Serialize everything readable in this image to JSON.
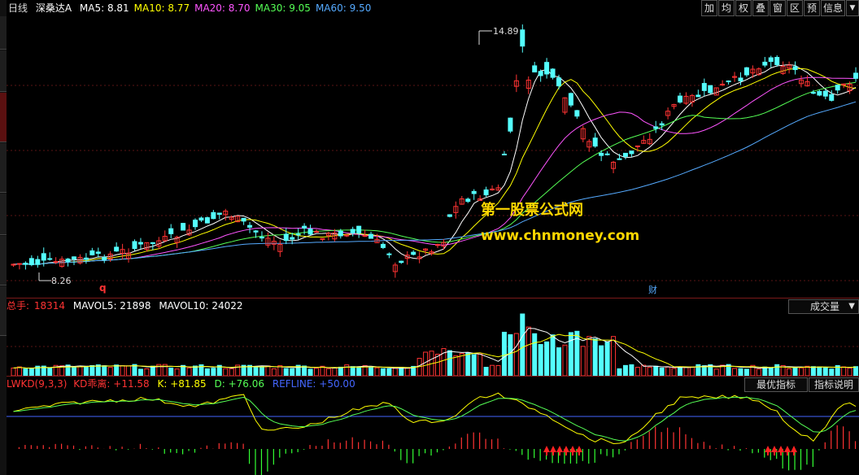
{
  "header": {
    "period": "日线",
    "stock_name": "深桑达A",
    "ma_items": [
      {
        "label": "MA5: 8.81",
        "color": "#ffffff"
      },
      {
        "label": "MA10: 8.77",
        "color": "#ffff00"
      },
      {
        "label": "MA20: 8.70",
        "color": "#ff55ff"
      },
      {
        "label": "MA30: 9.05",
        "color": "#55ff55"
      },
      {
        "label": "MA60: 9.50",
        "color": "#55aaff"
      }
    ]
  },
  "toolbar": {
    "buttons": [
      "加",
      "均",
      "权",
      "叠",
      "窗",
      "区",
      "预",
      "信息"
    ],
    "dropdown_icon": "chevron-down-icon"
  },
  "price_chart": {
    "high_label": "14.89",
    "low_label": "8.26",
    "marker_q": "q",
    "marker_cai": "财",
    "watermark_title": "第一股票公式网",
    "watermark_url": "www.chnmoney.com"
  },
  "volume_panel": {
    "total_label": "总手:",
    "total_value": "18314",
    "mavol5": "MAVOL5: 21898",
    "mavol10": "MAVOL10: 24022",
    "selector_label": "成交量",
    "selector_icon": "chevron-down-icon"
  },
  "indicator_panel": {
    "name": "LWKD(9,3,3)",
    "kd_dev": "KD乖离: +11.58",
    "k": "K: +81.85",
    "d": "D: +76.06",
    "refline": "REFLINE: +50.00",
    "btn_best": "最优指标",
    "btn_desc": "指标说明"
  },
  "colors": {
    "up": "#ff3333",
    "down": "#54ffff",
    "ma5": "#ffffff",
    "ma10": "#ffff00",
    "ma20": "#ff55ff",
    "ma30": "#55ff55",
    "ma60": "#55aaff",
    "refline": "#4466ff",
    "watermark": "#ffd700",
    "arrow": "#ff2222",
    "panel_sep": "#7a1a1a"
  }
}
